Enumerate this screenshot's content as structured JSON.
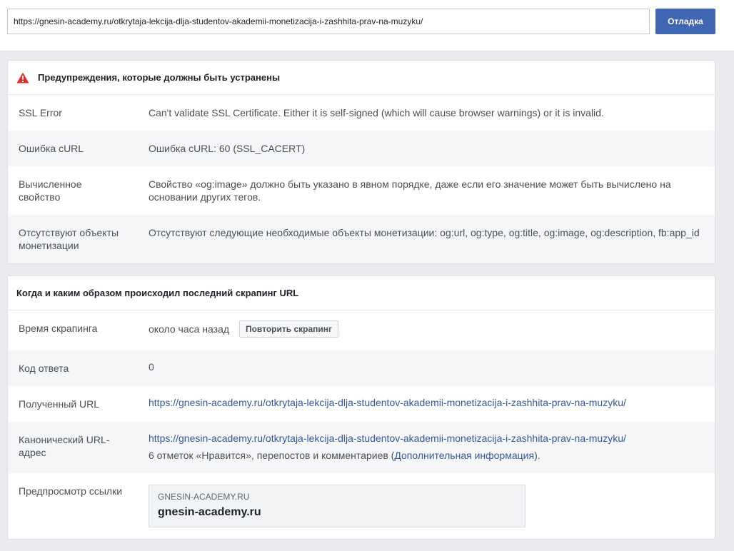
{
  "search": {
    "url_value": "https://gnesin-academy.ru/otkrytaja-lekcija-dlja-studentov-akademii-monetizacija-i-zashhita-prav-na-muzyku/",
    "debug_label": "Отладка"
  },
  "warnings": {
    "icon": "warning-triangle-icon",
    "title": "Предупреждения, которые должны быть устранены",
    "rows": [
      {
        "label": "SSL Error",
        "value": "Can't validate SSL Certificate. Either it is self-signed (which will cause browser warnings) or it is invalid."
      },
      {
        "label": "Ошибка cURL",
        "value": "Ошибка cURL: 60 (SSL_CACERT)"
      },
      {
        "label": "Вычисленное свойство",
        "value": "Свойство «og:image» должно быть указано в явном порядке, даже если его значение может быть вычислено на основании других тегов."
      },
      {
        "label": "Отсутствуют объекты монетизации",
        "value": "Отсутствуют следующие необходимые объекты монетизации: og:url, og:type, og:title, og:image, og:description, fb:app_id"
      }
    ]
  },
  "scrape": {
    "title": "Когда и каким образом происходил последний скрапинг URL",
    "time_label": "Время скрапинга",
    "time_value": "около часа назад",
    "rescrape_label": "Повторить скрапинг",
    "code_label": "Код ответа",
    "code_value": "0",
    "fetched_label": "Полученный URL",
    "fetched_value": "https://gnesin-academy.ru/otkrytaja-lekcija-dlja-studentov-akademii-monetizacija-i-zashhita-prav-na-muzyku/",
    "canonical_label": "Канонический URL-адрес",
    "canonical_value": "https://gnesin-academy.ru/otkrytaja-lekcija-dlja-studentov-akademii-monetizacija-i-zashhita-prav-na-muzyku/",
    "likes_text": "6 отметок «Нравится», перепостов и комментариев (",
    "more_info_link": "Дополнительная информация",
    "likes_suffix": ").",
    "preview_label": "Предпросмотр ссылки",
    "preview_domain": "GNESIN-ACADEMY.RU",
    "preview_title": "gnesin-academy.ru"
  },
  "colors": {
    "accent": "#4267b2",
    "link": "#365899",
    "warning": "#e02c2c"
  }
}
